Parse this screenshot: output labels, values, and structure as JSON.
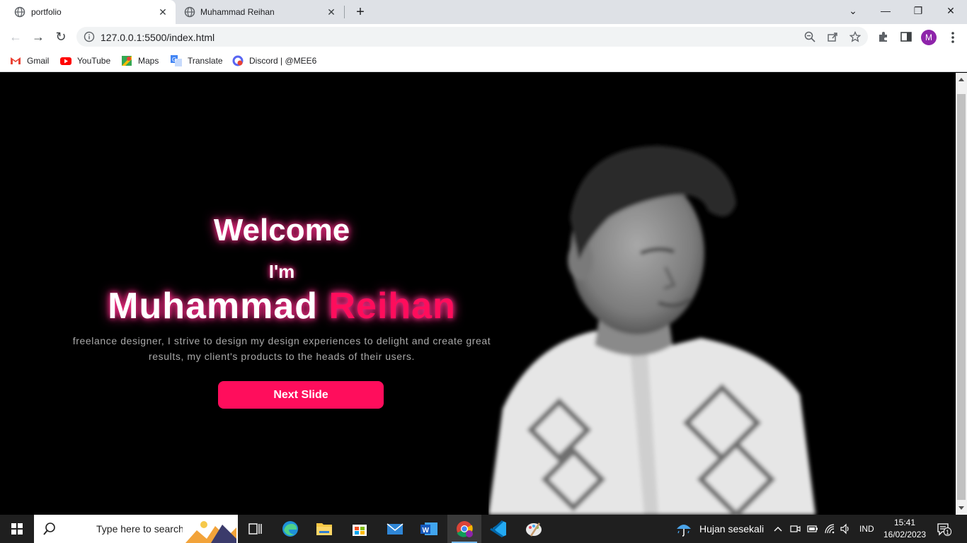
{
  "browser": {
    "tabs": [
      {
        "title": "portfolio",
        "active": true
      },
      {
        "title": "Muhammad Reihan",
        "active": false
      }
    ],
    "new_tab": "+",
    "url": "127.0.0.1:5500/index.html",
    "profile_initial": "M",
    "bookmarks": [
      {
        "label": "Gmail",
        "icon": "gmail-icon"
      },
      {
        "label": "YouTube",
        "icon": "youtube-icon"
      },
      {
        "label": "Maps",
        "icon": "maps-icon"
      },
      {
        "label": "Translate",
        "icon": "translate-icon"
      },
      {
        "label": "Discord | @MEE6",
        "icon": "discord-mee6-icon"
      }
    ]
  },
  "hero": {
    "welcome": "Welcome",
    "im": "I'm",
    "first_name": "Muhammad",
    "last_name": "Reihan",
    "description": "freelance designer, I strive to design my design experiences to delight and create great results, my client's products to the heads of their users.",
    "button_label": "Next Slide"
  },
  "taskbar": {
    "search_placeholder": "Type here to search",
    "weather": "Hujan sesekali",
    "language": "IND",
    "time": "15:41",
    "date": "16/02/2023",
    "notification_count": "1"
  },
  "colors": {
    "accent": "#ff0d5c",
    "glow": "#ff2d8a",
    "page_bg": "#000000",
    "taskbar_bg": "#1f1f1f"
  }
}
